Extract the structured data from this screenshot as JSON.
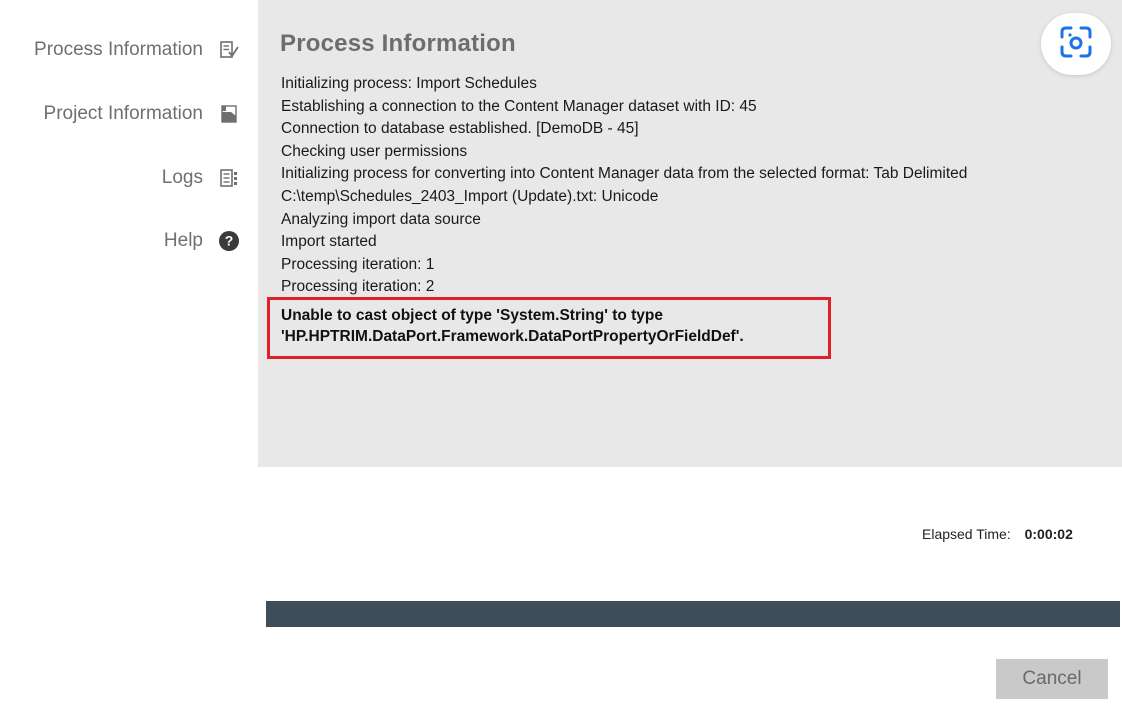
{
  "sidebar": {
    "items": [
      {
        "label": "Process Information",
        "icon": "process-checklist-icon"
      },
      {
        "label": "Project Information",
        "icon": "project-document-icon"
      },
      {
        "label": "Logs",
        "icon": "logs-list-icon"
      },
      {
        "label": "Help",
        "icon": "help-icon"
      }
    ]
  },
  "main": {
    "title": "Process Information",
    "log_lines": [
      "Initializing process: Import Schedules",
      "Establishing a connection to the Content Manager dataset with ID: 45",
      "Connection to database established. [DemoDB - 45]",
      "Checking user permissions",
      "Initializing process for converting into Content Manager data from the selected format: Tab Delimited",
      "C:\\temp\\Schedules_2403_Import (Update).txt: Unicode",
      "Analyzing import data source",
      "Import started",
      "Processing iteration: 1",
      "Processing iteration: 2"
    ],
    "error_lines": [
      "Unable to cast object of type 'System.String' to type",
      "'HP.HPTRIM.DataPort.Framework.DataPortPropertyOrFieldDef'."
    ],
    "elapsed_label": "Elapsed Time:",
    "elapsed_value": "0:00:02",
    "progress_fraction": 1.0,
    "cancel_label": "Cancel"
  },
  "overlay": {
    "icon": "visual-search-lens-icon"
  },
  "colors": {
    "panel_bg": "#e8e8e8",
    "error_border": "#e0202a",
    "progress_fill": "#3d4d59",
    "help_icon": "#3a3a3a"
  }
}
